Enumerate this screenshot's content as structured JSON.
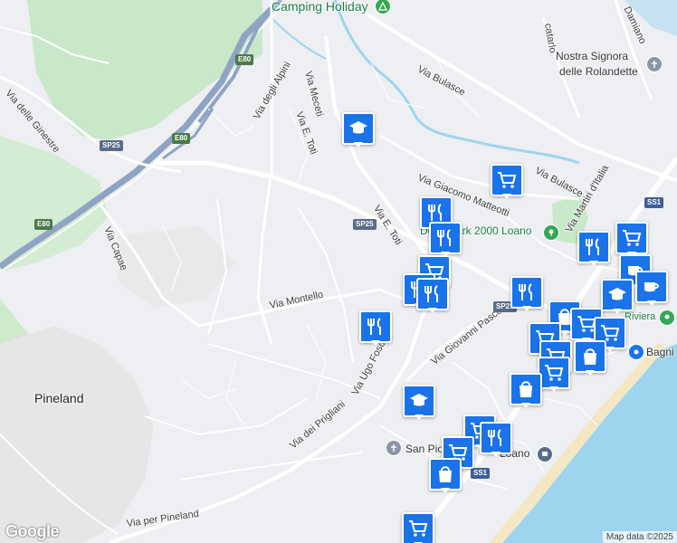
{
  "map": {
    "attribution": "Map data ©2025",
    "logo": "Google",
    "colors": {
      "land": "#eeeff2",
      "park": "#c8e8c9",
      "water": "#9fd4ee",
      "road": "#ffffff",
      "motorway": "#8fa4c4",
      "marker": "#1a73e8",
      "poi_green": "#34a853"
    },
    "labels": {
      "camping": "Camping Holiday",
      "nostra_signora": "Nostra Signora",
      "rolandette": "delle Rolandette",
      "via_bulasce_1": "Via Bulasce",
      "via_bulasce_2": "Via Bulasce",
      "via_delle_ginestre": "Via delle Ginestre",
      "via_degli_alpini": "Via degli Alpini",
      "via_meceti": "Via Meceti",
      "via_e_toti_1": "Via E. Toti",
      "via_e_toti_2": "Via E. Toti",
      "via_giacomo_matteotti": "Via Giacomo Matteotti",
      "via_capae": "Via Capae",
      "via_montello": "Via Montello",
      "via_giovanni_pascoli": "Via Giovanni Pascoli",
      "via_ugo_foscolo": "Via Ugo Foscolo",
      "via_dei_prigliani": "Via dei Prigliani",
      "via_per_pineland": "Via per Pineland",
      "pineland": "Pineland",
      "doria_2000": "Doria Park 2000 Loano",
      "san_pio": "San Pio",
      "loano": "Loano",
      "bagni": "Bagni",
      "riviera_label": "Riviera",
      "catarlo": "catarlo",
      "via_damiano": "Damiano",
      "via_martiri": "Via Martiri d'Italia"
    },
    "shields": {
      "e80_1": "E80",
      "e80_2": "E80",
      "e80_3": "E80",
      "sp25_1": "SP25",
      "sp25_2": "SP25",
      "sp25_3": "SP25",
      "ss1_1": "SS1",
      "ss1_2": "SS1"
    },
    "markers": [
      {
        "id": "school-1",
        "icon": "school-icon"
      },
      {
        "id": "shop-1",
        "icon": "shopping-cart-icon"
      },
      {
        "id": "rest-1",
        "icon": "restaurant-icon"
      },
      {
        "id": "rest-2",
        "icon": "restaurant-icon"
      },
      {
        "id": "shop-2",
        "icon": "shopping-cart-icon"
      },
      {
        "id": "rest-3",
        "icon": "restaurant-icon"
      },
      {
        "id": "rest-4",
        "icon": "restaurant-icon"
      },
      {
        "id": "rest-5",
        "icon": "restaurant-icon"
      },
      {
        "id": "rest-6",
        "icon": "restaurant-icon"
      },
      {
        "id": "cafe-1",
        "icon": "cafe-icon"
      },
      {
        "id": "cafe-2",
        "icon": "cafe-icon"
      },
      {
        "id": "shop-3",
        "icon": "shopping-cart-icon"
      },
      {
        "id": "school-2",
        "icon": "school-icon"
      },
      {
        "id": "bag-1",
        "icon": "shopping-bag-icon"
      },
      {
        "id": "cart-cluster",
        "icon": "shopping-cart-icon"
      },
      {
        "id": "bag-2",
        "icon": "shopping-bag-icon"
      },
      {
        "id": "bag-3",
        "icon": "shopping-bag-icon"
      },
      {
        "id": "school-3",
        "icon": "school-icon"
      },
      {
        "id": "cart-4",
        "icon": "shopping-cart-icon"
      },
      {
        "id": "bag-4",
        "icon": "shopping-bag-icon"
      },
      {
        "id": "cart-5",
        "icon": "shopping-cart-icon"
      }
    ]
  }
}
